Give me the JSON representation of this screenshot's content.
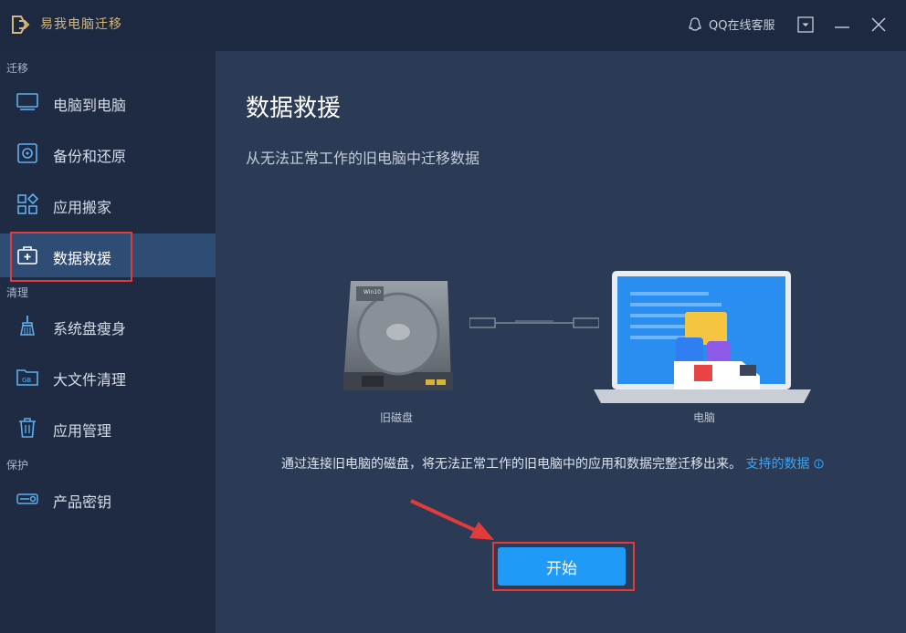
{
  "app": {
    "title": "易我电脑迁移",
    "support": "QQ在线客服"
  },
  "sidebar": {
    "sections": {
      "migrate": "迁移",
      "clean": "清理",
      "protect": "保护"
    },
    "items": [
      {
        "label": "电脑到电脑",
        "icon": "monitor-icon"
      },
      {
        "label": "备份和还原",
        "icon": "backup-disk-icon"
      },
      {
        "label": "应用搬家",
        "icon": "apps-grid-icon"
      },
      {
        "label": "数据救援",
        "icon": "medkit-icon"
      },
      {
        "label": "系统盘瘦身",
        "icon": "broom-icon"
      },
      {
        "label": "大文件清理",
        "icon": "folder-gb-icon"
      },
      {
        "label": "应用管理",
        "icon": "trash-icon"
      },
      {
        "label": "产品密钥",
        "icon": "key-icon"
      }
    ],
    "active_index": 3
  },
  "main": {
    "title": "数据救援",
    "subtitle": "从无法正常工作的旧电脑中迁移数据",
    "disk_label": "旧磁盘",
    "disk_badge": "Win10",
    "pc_label": "电脑",
    "description": "通过连接旧电脑的磁盘，将无法正常工作的旧电脑中的应用和数据完整迁移出来。",
    "link_text": "支持的数据",
    "start_label": "开始"
  },
  "colors": {
    "accent": "#1f9af6",
    "highlight": "#e23b3b",
    "brand": "#d6b777",
    "link": "#3da5f6"
  }
}
